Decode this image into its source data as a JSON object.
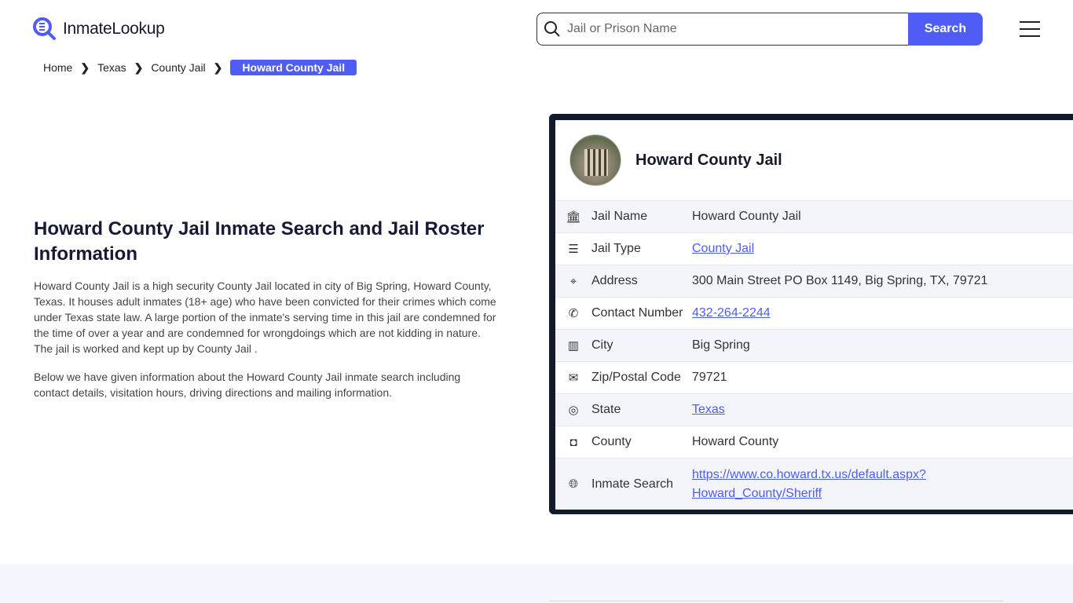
{
  "header": {
    "logo": "InmateLookup",
    "search_placeholder": "Jail or Prison Name",
    "search_button": "Search"
  },
  "breadcrumb": [
    "Home",
    "Texas",
    "County Jail",
    "Howard County Jail"
  ],
  "main": {
    "title": "Howard County Jail Inmate Search and Jail Roster Information",
    "paragraphs": [
      "Howard County Jail is a high security County Jail located in city of Big Spring, Howard County, Texas. It houses adult inmates (18+ age) who have been convicted for their crimes which come under Texas state law. A large portion of the inmate's serving time in this jail are condemned for the time of over a year and are condemned for wrongdoings which are not kidding in nature. The jail is worked and kept up by County Jail .",
      "Below we have given information about the Howard County Jail inmate search including contact details, visitation hours, driving directions and mailing information."
    ]
  },
  "card": {
    "title": "Howard County Jail",
    "rows": [
      {
        "icon": "bank-icon",
        "label": "Jail Name",
        "value": "Howard County Jail"
      },
      {
        "icon": "list-icon",
        "label": "Jail Type",
        "value": "County Jail"
      },
      {
        "icon": "map-pin-icon",
        "label": "Address",
        "value": "300 Main Street PO Box 1149, Big Spring, TX, 79721"
      },
      {
        "icon": "phone-icon",
        "label": "Contact Number",
        "value": "432-264-2244"
      },
      {
        "icon": "map-icon",
        "label": "City",
        "value": "Big Spring"
      },
      {
        "icon": "mail-icon",
        "label": "Zip/Postal Code",
        "value": "79721"
      },
      {
        "icon": "globe-icon",
        "label": "State",
        "value": "Texas"
      },
      {
        "icon": "county-icon",
        "label": "County",
        "value": "Howard County"
      },
      {
        "icon": "web-icon",
        "label": "Inmate Search",
        "value_line1": "https://www.co.howard.tx.us/default.aspx?",
        "value_line2": "Howard_County/Sheriff"
      }
    ]
  },
  "colors": {
    "accent": "#4f5cf6",
    "card_border": "#141a2e"
  }
}
